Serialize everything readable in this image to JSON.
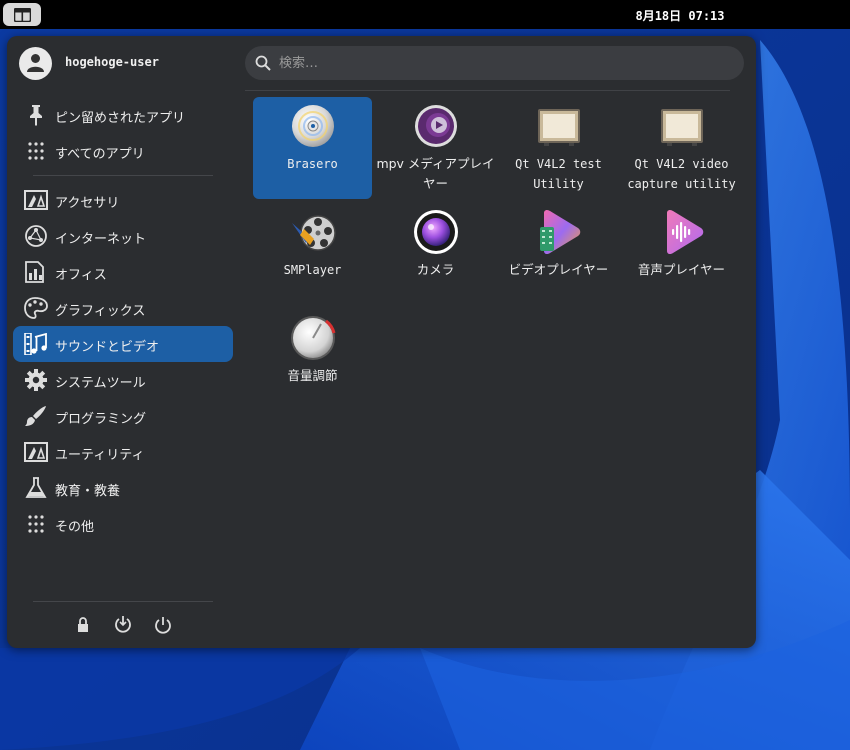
{
  "top_panel": {
    "clock": "8月18日 07:13"
  },
  "menu": {
    "user_name": "hogehoge-user",
    "search": {
      "placeholder": "検索…"
    },
    "categories": [
      {
        "label": "ピン留めされたアプリ",
        "icon": "pin-icon"
      },
      {
        "label": "すべてのアプリ",
        "icon": "grid-icon"
      },
      {
        "label": "アクセサリ",
        "icon": "accessories-icon"
      },
      {
        "label": "インターネット",
        "icon": "internet-icon"
      },
      {
        "label": "オフィス",
        "icon": "office-icon"
      },
      {
        "label": "グラフィックス",
        "icon": "graphics-icon"
      },
      {
        "label": "サウンドとビデオ",
        "icon": "multimedia-icon",
        "active": true
      },
      {
        "label": "システムツール",
        "icon": "system-gear-icon"
      },
      {
        "label": "プログラミング",
        "icon": "programming-icon"
      },
      {
        "label": "ユーティリティ",
        "icon": "utilities-icon"
      },
      {
        "label": "教育・教養",
        "icon": "education-flask-icon"
      },
      {
        "label": "その他",
        "icon": "other-grid-icon"
      }
    ],
    "session_buttons": [
      "lock-icon",
      "logout-icon",
      "power-icon"
    ],
    "apps": [
      {
        "label": "Brasero",
        "icon": "brasero-disc-icon",
        "selected": true
      },
      {
        "label": "mpv メディアプレイヤー",
        "icon": "mpv-icon"
      },
      {
        "label": "Qt V4L2 test Utility",
        "icon": "qv4l2-icon"
      },
      {
        "label": "Qt V4L2 video capture utility",
        "icon": "qvidcap-icon"
      },
      {
        "label": "SMPlayer",
        "icon": "smplayer-icon"
      },
      {
        "label": "カメラ",
        "icon": "camera-icon"
      },
      {
        "label": "ビデオプレイヤー",
        "icon": "video-player-icon"
      },
      {
        "label": "音声プレイヤー",
        "icon": "audio-player-icon"
      },
      {
        "label": "音量調節",
        "icon": "volume-control-icon"
      }
    ]
  },
  "colors": {
    "accent": "#1d5fa5",
    "menu_background": "#2b2d30",
    "panel_background": "#000000"
  }
}
